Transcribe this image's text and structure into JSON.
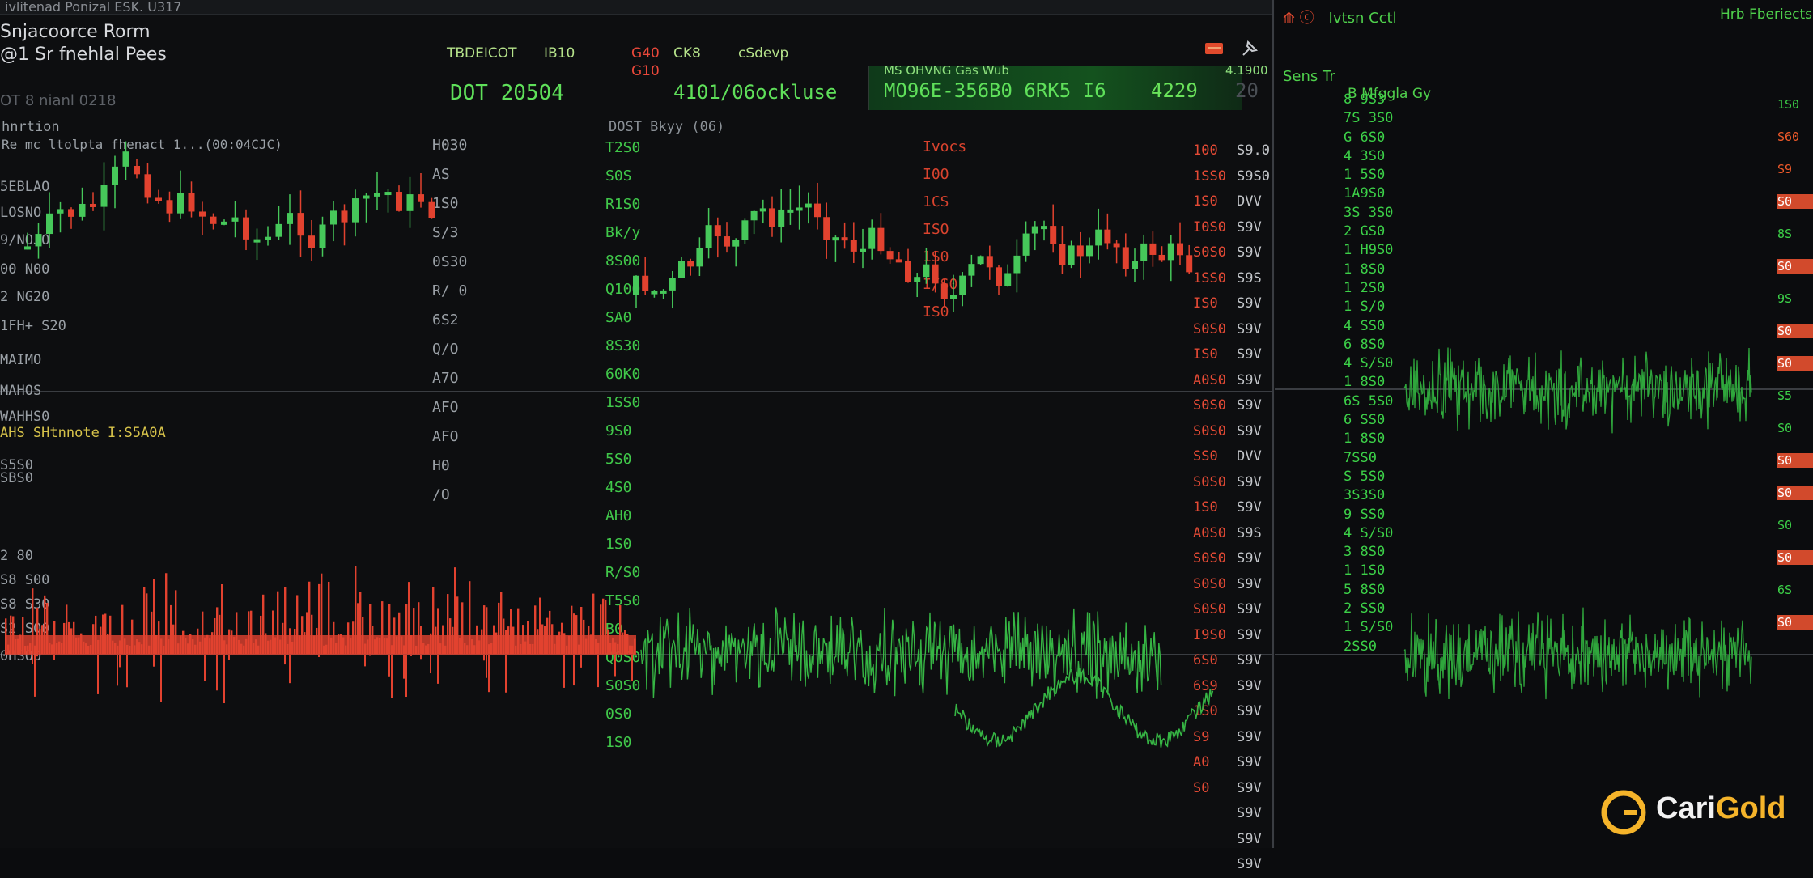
{
  "topbar": {
    "text": "ivlitenad Ponizal    ESK. U317"
  },
  "header": {
    "title_line1": "Snjacoorce Rorm",
    "title_line2": "@1 Sr fnehlal Pees",
    "subtitle": "OT 8 nianl 0218",
    "col1_label": "TBDEICOT",
    "col1_value": "DOT 20504",
    "col2_label": "IB10",
    "col3_label": "G40",
    "col3_sub": "G10",
    "col4_label": "CK8",
    "col4_value": "4101/06ockluse",
    "col5_label": "cSdevp",
    "ticker_label": "MS OHVNG Gas Wub",
    "ticker_right_label": "4.1900",
    "ticker_value": "MO96E-356B0 6RK5 I6",
    "ticker_price": "4229",
    "ticker_suffix": "20"
  },
  "panel": {
    "label_top": "hnrtion",
    "label_sub": "Re mc ltolpta fhenact 1...(00:04CJC)",
    "center_label": "DOST Bkyy (06)",
    "left_axis": [
      "5EBLAO",
      "LOSNO",
      "9/NOJO",
      "00 N00",
      "2 NG20",
      "1FH+ S20",
      "MAIMO",
      "MAHOS",
      "WAHHS0",
      "AHS SHtnnote I:S5A0A",
      "S5S0",
      "SBS0",
      "2 80",
      "S8 S00",
      "S8 S30",
      "S2 S00",
      "0HSO0"
    ],
    "mid_axis": [
      "H030",
      "AS",
      "1S0",
      "S/3",
      "0S30",
      "R/ 0",
      "6S2",
      "Q/O",
      "A7O",
      "AFO",
      "AFO",
      "H0",
      "/O"
    ],
    "scale_green": [
      "T2S0",
      "S0S",
      "R1S0",
      "Bk/y",
      "8S00",
      "Q100",
      "SA0",
      "8S30",
      "60K0",
      "1SS0",
      "9S0",
      "5S0",
      "4S0",
      "AH0",
      "1S0",
      "R/S0",
      "T5S0",
      "B0",
      "Q0S0",
      "S0S0",
      "0S0",
      "1S0"
    ],
    "scale_red": [
      "Ivocs",
      "I0O",
      "1CS",
      "ISO",
      "1S0",
      "I/S0",
      "IS0"
    ],
    "right_scale_red": [
      "100",
      "1SS0",
      "1S0",
      "I0S0",
      "S0S0",
      "1SS0",
      "IS0",
      "S0S0",
      "IS0",
      "A0S0",
      "S0S0",
      "S0S0",
      "SS0",
      "S0S0",
      "1S0",
      "A0S0",
      "S0S0",
      "S0S0",
      "S0S0",
      "I9S0",
      "6S0",
      "6S9",
      "1S0",
      "S9",
      "A0",
      "S0"
    ],
    "right_scale_white": [
      "S9.0",
      "S9S0",
      "DVV",
      "S9V",
      "S9V",
      "S9S",
      "S9V",
      "S9V",
      "S9V",
      "S9V",
      "S9V",
      "S9V",
      "DVV",
      "S9V",
      "S9V",
      "S9S",
      "S9V",
      "S9V",
      "S9V",
      "S9V",
      "S9V",
      "S9V",
      "S9V",
      "S9V",
      "S9V",
      "S9V",
      "S9V",
      "S9V",
      "S9V"
    ]
  },
  "right_panel": {
    "header_left": "Ivtsn Cctl",
    "header_right": "Hrb Fberiects",
    "sub_label": "Sens Tr",
    "sub_label2": "B Mfggla Gy",
    "depth_values": [
      "8 9S3",
      "7S 3S0",
      "G 6S0",
      "4 3S0",
      "1 5S0",
      "1A9S0",
      "3S 3S0",
      "2 GS0",
      "1 H9S0",
      "1 8S0",
      "1 2S0",
      "1 S/0",
      "4 SS0",
      "6 8S0",
      "4 S/S0",
      "1 8S0",
      "6S 5S0",
      "6 SS0",
      "1 8S0",
      "7SS0",
      "S 5S0",
      "3S3S0",
      "9 SS0",
      "4 S/S0",
      "3 8S0",
      "1 1S0",
      "5 8S0",
      "2 SS0",
      "1 S/S0",
      "2SS0"
    ],
    "edge_values": [
      "1S0",
      "S60",
      "S9",
      "S0",
      "8S",
      "S0",
      "9S",
      "S0",
      "S0",
      "S5",
      "S0",
      "S0",
      "S0",
      "S0",
      "S0",
      "6S",
      "S0"
    ]
  },
  "brand": {
    "name_part1": "Cari",
    "name_part2": "Gold"
  },
  "colors": {
    "up": "#46c85a",
    "down": "#e2422f",
    "accent_green": "#3cd048",
    "brand_gold": "#f5b42a"
  }
}
